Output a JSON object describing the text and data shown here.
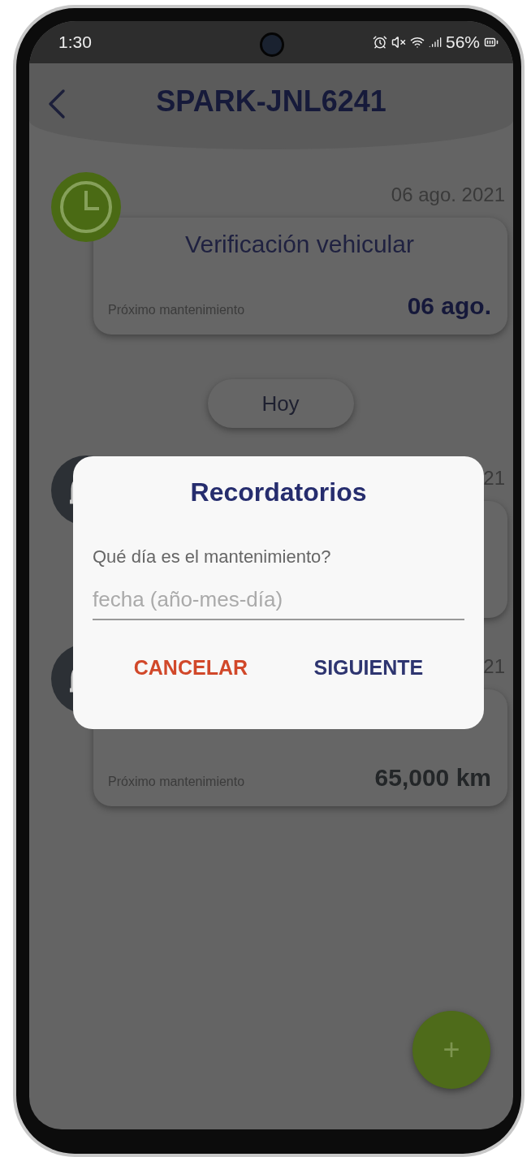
{
  "status_bar": {
    "time": "1:30",
    "battery": "56%"
  },
  "header": {
    "title": "SPARK-JNL6241"
  },
  "entries": [
    {
      "kind": "clock",
      "date": "06 ago. 2021",
      "title": "Verificación vehicular",
      "label": "Próximo mantenimiento",
      "value": "06 ago."
    },
    {
      "kind": "separator",
      "label": "Hoy"
    },
    {
      "kind": "bell",
      "date": "21"
    },
    {
      "kind": "bell",
      "date": "21",
      "label": "Próximo mantenimiento",
      "value": "65,000 km"
    }
  ],
  "dialog": {
    "title": "Recordatorios",
    "question": "Qué día es el mantenimiento?",
    "placeholder": "fecha (año-mes-día)",
    "buttons": [
      {
        "kind": "cancel",
        "label": "CANCELAR"
      },
      {
        "kind": "confirm",
        "label": "SIGUIENTE"
      }
    ]
  },
  "fab": {
    "label": "+"
  }
}
